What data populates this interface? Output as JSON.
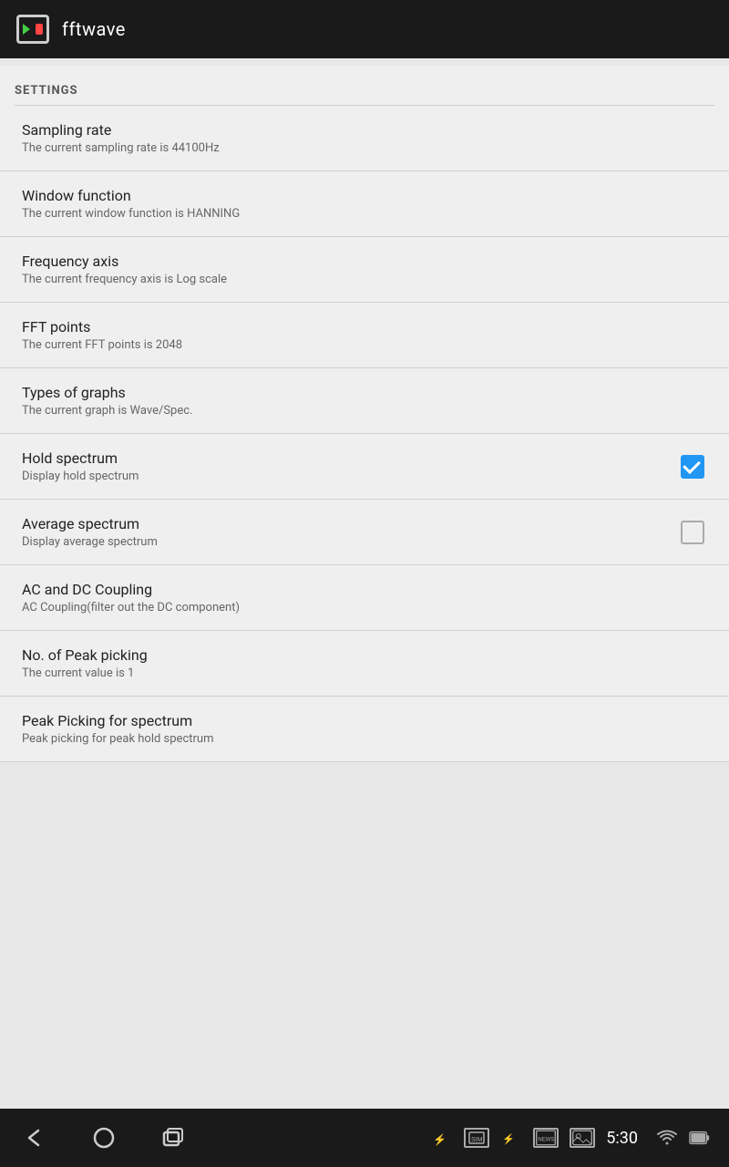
{
  "app": {
    "title": "fftwave"
  },
  "settings": {
    "section_label": "SETTINGS",
    "items": [
      {
        "id": "sampling-rate",
        "title": "Sampling rate",
        "subtitle": "The current sampling rate is 44100Hz",
        "has_checkbox": false,
        "checked": null
      },
      {
        "id": "window-function",
        "title": "Window function",
        "subtitle": "The current window function is HANNING",
        "has_checkbox": false,
        "checked": null
      },
      {
        "id": "frequency-axis",
        "title": "Frequency axis",
        "subtitle": "The current frequency axis is Log scale",
        "has_checkbox": false,
        "checked": null
      },
      {
        "id": "fft-points",
        "title": "FFT points",
        "subtitle": "The current FFT points is 2048",
        "has_checkbox": false,
        "checked": null
      },
      {
        "id": "types-of-graphs",
        "title": "Types of graphs",
        "subtitle": "The current graph is Wave/Spec.",
        "has_checkbox": false,
        "checked": null
      },
      {
        "id": "hold-spectrum",
        "title": "Hold spectrum",
        "subtitle": "Display hold spectrum",
        "has_checkbox": true,
        "checked": true
      },
      {
        "id": "average-spectrum",
        "title": "Average spectrum",
        "subtitle": "Display average spectrum",
        "has_checkbox": true,
        "checked": false
      },
      {
        "id": "ac-dc-coupling",
        "title": "AC and DC Coupling",
        "subtitle": "AC Coupling(filter out the DC component)",
        "has_checkbox": false,
        "checked": null
      },
      {
        "id": "peak-picking-no",
        "title": "No. of Peak picking",
        "subtitle": "The current value is 1",
        "has_checkbox": false,
        "checked": null
      },
      {
        "id": "peak-picking-spectrum",
        "title": "Peak Picking for spectrum",
        "subtitle": "Peak picking for peak hold spectrum",
        "has_checkbox": false,
        "checked": null
      }
    ]
  },
  "navbar": {
    "time": "5:30"
  }
}
